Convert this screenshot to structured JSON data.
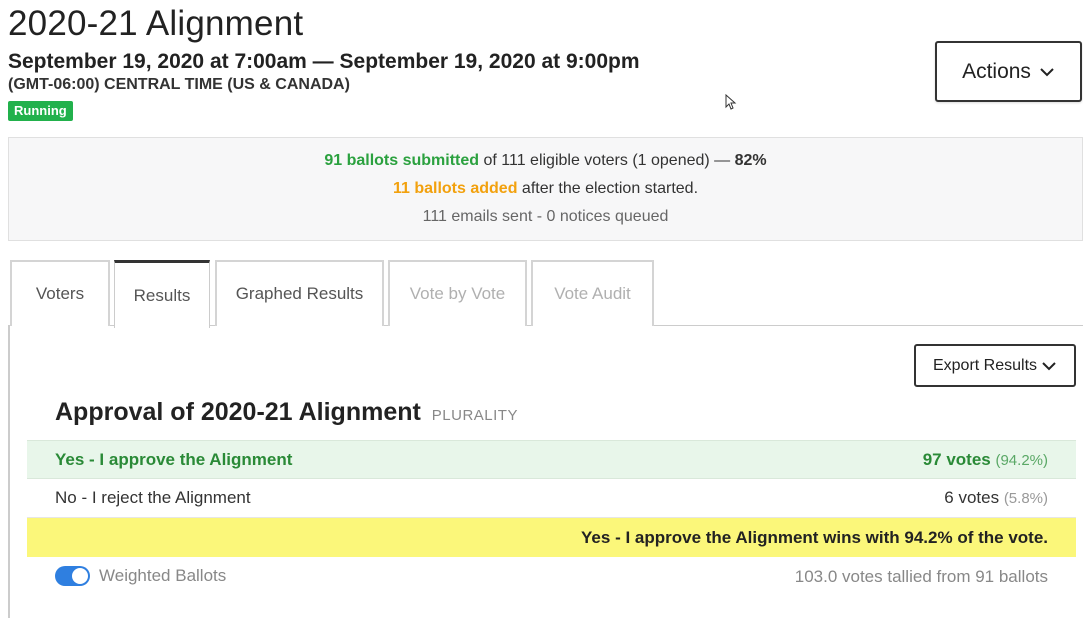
{
  "header": {
    "title": "2020-21 Alignment",
    "dates": "September 19, 2020 at 7:00am — September 19, 2020 at 9:00pm",
    "timezone": "(GMT-06:00) CENTRAL TIME (US & CANADA)",
    "status": "Running",
    "actions_label": "Actions"
  },
  "stats": {
    "submitted": "91 ballots submitted",
    "eligible": " of 111 eligible voters (1 opened) — ",
    "percent": "82%",
    "added": "11 ballots added",
    "added_suffix": " after the election started.",
    "emails": "111 emails sent - 0 notices queued"
  },
  "tabs": [
    {
      "label": "Voters"
    },
    {
      "label": "Results"
    },
    {
      "label": "Graphed Results"
    },
    {
      "label": "Vote by Vote"
    },
    {
      "label": "Vote Audit"
    }
  ],
  "results": {
    "export_label": "Export Results",
    "question_title": "Approval of 2020-21 Alignment",
    "method": "PLURALITY",
    "options": [
      {
        "label": "Yes - I approve the Alignment",
        "votes": "97 votes",
        "pct": "(94.2%)"
      },
      {
        "label": "No - I reject the Alignment",
        "votes": "6 votes",
        "pct": "(5.8%)"
      }
    ],
    "winner_text": "Yes - I approve the Alignment wins with 94.2% of the vote.",
    "weighted_label": "Weighted Ballots",
    "tally": "103.0 votes tallied from 91 ballots"
  },
  "colors": {
    "running_badge": "#22b14c",
    "submitted_green": "#2ba13f",
    "added_orange": "#f2a10e",
    "winner_row": "#e8f6ea",
    "banner_yellow": "#fbf77a",
    "toggle_blue": "#2f7fe0"
  },
  "icons": {
    "actions": "chevron-down-icon",
    "export": "chevron-down-icon",
    "pointer": "mouse-pointer-icon"
  }
}
